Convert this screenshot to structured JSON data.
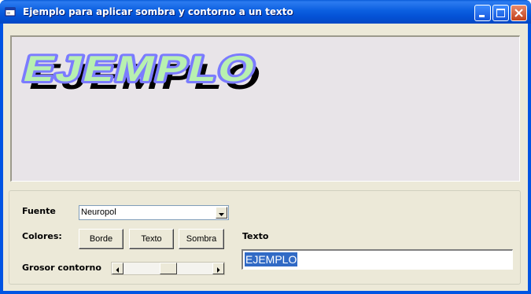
{
  "window": {
    "title": "Ejemplo para aplicar sombra y contorno a un texto",
    "app_icon": "vb-form-icon",
    "controls": [
      "minimize-icon",
      "maximize-icon",
      "close-icon"
    ]
  },
  "preview": {
    "text": "EJEMPLO",
    "fill_color": "#b8f0b0",
    "outline_color": "#7b7bff",
    "shadow_color": "#000000",
    "background": "#e8e4e8"
  },
  "form": {
    "font_label": "Fuente",
    "font_value": "Neuropol",
    "colors_label": "Colores:",
    "buttons": {
      "border": "Borde",
      "text": "Texto",
      "shadow": "Sombra"
    },
    "text_label": "Texto",
    "text_value": "EJEMPLO",
    "outline_label": "Grosor contorno",
    "outline_level": 0.5
  },
  "colors": {
    "titlebar": "#0054e3",
    "client": "#ece9d8",
    "selection": "#316ac5"
  }
}
